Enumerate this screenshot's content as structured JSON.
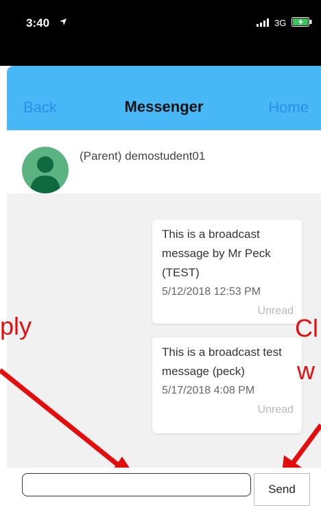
{
  "status_bar": {
    "time": "3:40",
    "network": "3G",
    "location_icon": "location-arrow-icon",
    "signal_icon": "signal-bars-icon",
    "battery_icon": "battery-charging-icon"
  },
  "nav": {
    "back_label": "Back",
    "title": "Messenger",
    "home_label": "Home",
    "accent": "#47b8f5"
  },
  "contact": {
    "name": "(Parent) demostudent01",
    "avatar_icon": "person-avatar-icon"
  },
  "messages": [
    {
      "text": "This is a broadcast message by Mr Peck (TEST)",
      "timestamp": "5/12/2018 12:53 PM",
      "status": "Unread"
    },
    {
      "text": "This is a broadcast test message (peck)",
      "timestamp": "5/17/2018 4:08 PM",
      "status": "Unread"
    }
  ],
  "annotations": {
    "left": "ply",
    "right_line1": "Cl",
    "right_line2": "w",
    "color": "#e30d0d"
  },
  "composer": {
    "input_value": "",
    "send_label": "Send"
  }
}
